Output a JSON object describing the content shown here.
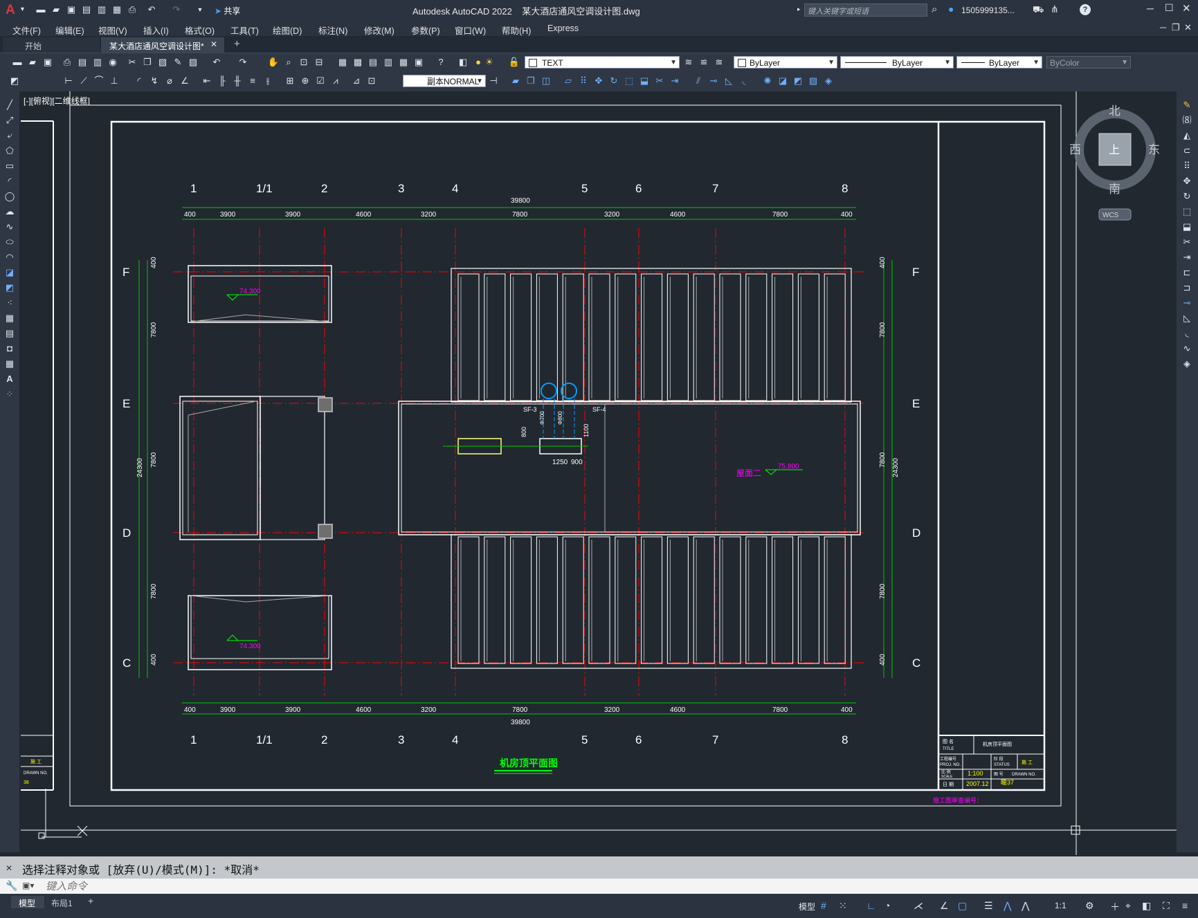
{
  "app": {
    "title": "Autodesk AutoCAD 2022    某大酒店通风空调设计图.dwg",
    "search_placeholder": "键入关键字或短语",
    "user": "1505999135...",
    "share": "共享"
  },
  "menu": [
    "文件(F)",
    "编辑(E)",
    "视图(V)",
    "插入(I)",
    "格式(O)",
    "工具(T)",
    "绘图(D)",
    "标注(N)",
    "修改(M)",
    "参数(P)",
    "窗口(W)",
    "帮助(H)",
    "Express"
  ],
  "tabs": {
    "start": "开始",
    "drawing": "某大酒店通风空调设计图*",
    "add": "+"
  },
  "toolbar": {
    "layer_name": "TEXT",
    "color": "ByLayer",
    "linetype": "ByLayer",
    "lineweight": "ByLayer",
    "plotstyle": "ByColor",
    "dimstyle": "副本NORMAL"
  },
  "viewport": {
    "label": "[-][俯视][二维线框]"
  },
  "viewcube": {
    "north": "北",
    "south": "南",
    "east": "东",
    "west": "西",
    "face": "上",
    "wcs": "WCS"
  },
  "drawing": {
    "grid_top": [
      "1",
      "1/1",
      "2",
      "3",
      "4",
      "5",
      "6",
      "7",
      "8"
    ],
    "grid_side": [
      "F",
      "E",
      "D",
      "C"
    ],
    "dims_top": [
      "400",
      "3900",
      "3900",
      "4600",
      "3200",
      "7800",
      "3200",
      "4600",
      "7800",
      "400"
    ],
    "total": "39800",
    "dims_side_left": [
      "400",
      "7800",
      "7800",
      "7800",
      "400"
    ],
    "side_total": "24300",
    "level1": "74.300",
    "level2": "74.300",
    "level_roof": "75.800",
    "roof_label": "屋面二",
    "sf3": "SF-3",
    "sf4": "SF-4",
    "d1": "1250",
    "d2": "900",
    "d3": "800",
    "d4": "1100",
    "d5": "Φ700",
    "d6": "Φ800",
    "drawing_title": "机房顶平面图",
    "tb_name": "机房顶平面图",
    "tb_scale": "1:100",
    "tb_date": "2007.12",
    "tb_no": "暖37",
    "tb_title_label": "图 名",
    "tb_title_en": "TITLE",
    "tb_proj": "工程编号",
    "tb_proj_en": "PROJ. NO.",
    "tb_status": "阶 段",
    "tb_status_en": "STATUS",
    "tb_stage": "施 工",
    "tb_scale_label": "比 例",
    "tb_scale_en": "SCALE",
    "tb_dwg": "图 号",
    "tb_dwg_en": "DRAWN NO.",
    "tb_date_label": "日 期",
    "stamp": "施工图审查编号：",
    "left_stage": "施 工",
    "left_no": "DRAWN NO.",
    "left_num": "38"
  },
  "command": {
    "history": "选择注释对象或 [放弃(U)/模式(M)]: *取消*",
    "placeholder": "键入命令"
  },
  "status": {
    "model": "模型",
    "layout": "布局1",
    "add": "+",
    "model_btn": "模型",
    "scale": "1:1"
  }
}
